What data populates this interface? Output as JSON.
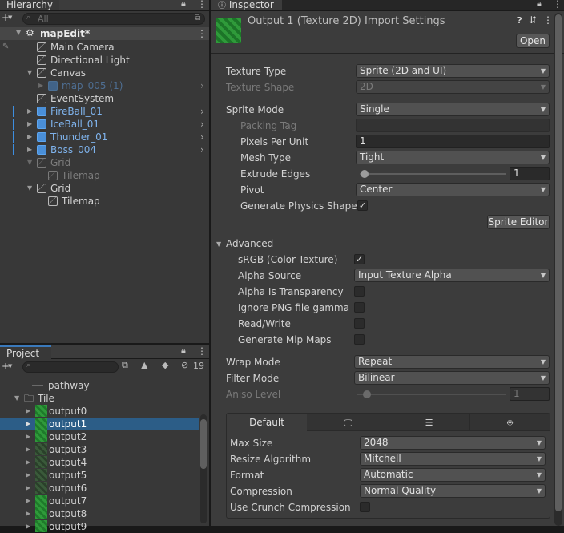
{
  "hierarchy": {
    "tab": "Hierarchy",
    "search_placeholder": "All",
    "scene": "mapEdit*",
    "items": [
      {
        "label": "Main Camera"
      },
      {
        "label": "Directional Light"
      },
      {
        "label": "Canvas"
      },
      {
        "label": "map_005 (1)"
      },
      {
        "label": "EventSystem"
      },
      {
        "label": "FireBall_01"
      },
      {
        "label": "IceBall_01"
      },
      {
        "label": "Thunder_01"
      },
      {
        "label": "Boss_004"
      },
      {
        "label": "Grid"
      },
      {
        "label": "Tilemap"
      },
      {
        "label": "Grid"
      },
      {
        "label": "Tilemap"
      }
    ]
  },
  "project": {
    "tab": "Project",
    "hidden_count": "19",
    "items": [
      {
        "label": "pathway"
      },
      {
        "label": "Tile"
      },
      {
        "label": "output0"
      },
      {
        "label": "output1"
      },
      {
        "label": "output2"
      },
      {
        "label": "output3"
      },
      {
        "label": "output4"
      },
      {
        "label": "output5"
      },
      {
        "label": "output6"
      },
      {
        "label": "output7"
      },
      {
        "label": "output8"
      },
      {
        "label": "output9"
      }
    ]
  },
  "inspector": {
    "tab": "Inspector",
    "title": "Output 1 (Texture 2D) Import Settings",
    "open": "Open",
    "texture_type": {
      "label": "Texture Type",
      "value": "Sprite (2D and UI)"
    },
    "texture_shape": {
      "label": "Texture Shape",
      "value": "2D"
    },
    "sprite_mode": {
      "label": "Sprite Mode",
      "value": "Single"
    },
    "packing_tag": {
      "label": "Packing Tag",
      "value": ""
    },
    "ppu": {
      "label": "Pixels Per Unit",
      "value": "1"
    },
    "mesh_type": {
      "label": "Mesh Type",
      "value": "Tight"
    },
    "extrude": {
      "label": "Extrude Edges",
      "value": "1"
    },
    "pivot": {
      "label": "Pivot",
      "value": "Center"
    },
    "gen_physics": {
      "label": "Generate Physics Shape"
    },
    "sprite_editor": "Sprite Editor",
    "advanced": "Advanced",
    "srgb": {
      "label": "sRGB (Color Texture)"
    },
    "alpha_source": {
      "label": "Alpha Source",
      "value": "Input Texture Alpha"
    },
    "alpha_transp": {
      "label": "Alpha Is Transparency"
    },
    "ignore_png": {
      "label": "Ignore PNG file gamma"
    },
    "read_write": {
      "label": "Read/Write"
    },
    "mipmaps": {
      "label": "Generate Mip Maps"
    },
    "wrap_mode": {
      "label": "Wrap Mode",
      "value": "Repeat"
    },
    "filter_mode": {
      "label": "Filter Mode",
      "value": "Bilinear"
    },
    "aniso": {
      "label": "Aniso Level",
      "value": "1"
    },
    "platform_default": "Default",
    "max_size": {
      "label": "Max Size",
      "value": "2048"
    },
    "resize": {
      "label": "Resize Algorithm",
      "value": "Mitchell"
    },
    "format": {
      "label": "Format",
      "value": "Automatic"
    },
    "compression": {
      "label": "Compression",
      "value": "Normal Quality"
    },
    "crunch": {
      "label": "Use Crunch Compression"
    }
  }
}
